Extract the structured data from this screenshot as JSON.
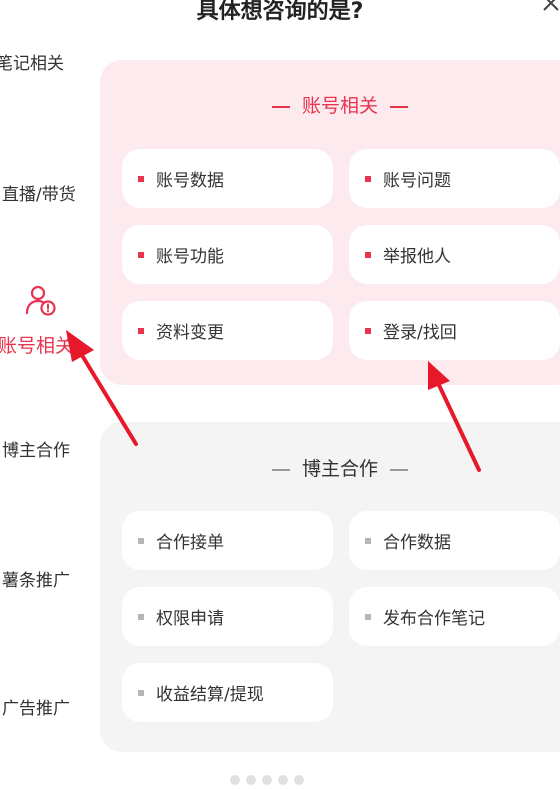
{
  "header": {
    "title": "具体想咨询的是?"
  },
  "sidebar": {
    "items": [
      {
        "label": "笔记相关"
      },
      {
        "label": "直播/带货"
      },
      {
        "label": "账号相关",
        "icon": "user-alert-icon"
      },
      {
        "label": "博主合作"
      },
      {
        "label": "薯条推广"
      },
      {
        "label": "广告推广"
      }
    ]
  },
  "sections": [
    {
      "title": "账号相关",
      "options": [
        "账号数据",
        "账号问题",
        "账号功能",
        "举报他人",
        "资料变更",
        "登录/找回"
      ]
    },
    {
      "title": "博主合作",
      "options": [
        "合作接单",
        "合作数据",
        "权限申请",
        "发布合作笔记",
        "收益结算/提现"
      ]
    }
  ],
  "colors": {
    "accent": "#e8344e",
    "active_panel": "#fdeaee",
    "inactive_panel": "#f4f4f4",
    "annotation_arrow": "#e8182b"
  }
}
